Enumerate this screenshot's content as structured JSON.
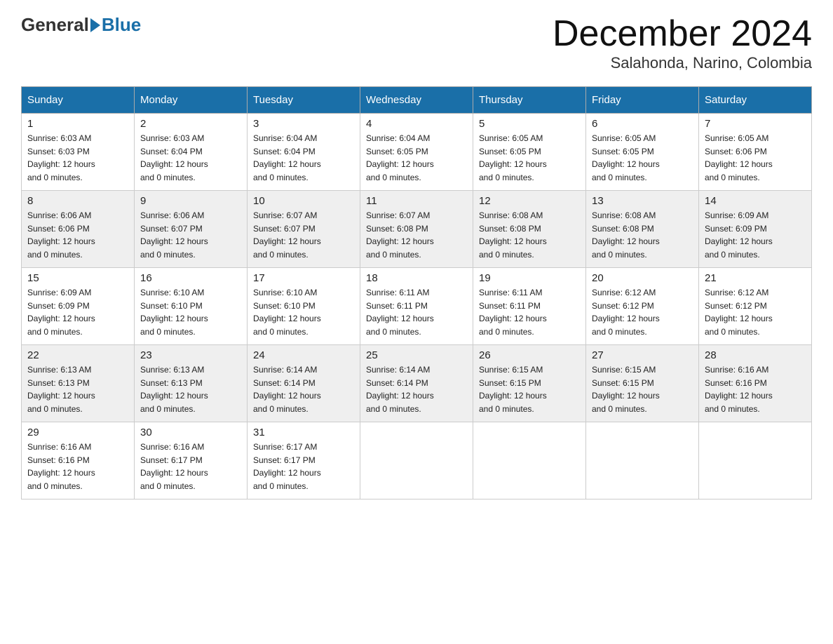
{
  "header": {
    "logo_general": "General",
    "logo_blue": "Blue",
    "month_title": "December 2024",
    "location": "Salahonda, Narino, Colombia"
  },
  "weekdays": [
    "Sunday",
    "Monday",
    "Tuesday",
    "Wednesday",
    "Thursday",
    "Friday",
    "Saturday"
  ],
  "weeks": [
    [
      {
        "day": "1",
        "sunrise": "6:03 AM",
        "sunset": "6:03 PM",
        "daylight": "12 hours and 0 minutes."
      },
      {
        "day": "2",
        "sunrise": "6:03 AM",
        "sunset": "6:04 PM",
        "daylight": "12 hours and 0 minutes."
      },
      {
        "day": "3",
        "sunrise": "6:04 AM",
        "sunset": "6:04 PM",
        "daylight": "12 hours and 0 minutes."
      },
      {
        "day": "4",
        "sunrise": "6:04 AM",
        "sunset": "6:05 PM",
        "daylight": "12 hours and 0 minutes."
      },
      {
        "day": "5",
        "sunrise": "6:05 AM",
        "sunset": "6:05 PM",
        "daylight": "12 hours and 0 minutes."
      },
      {
        "day": "6",
        "sunrise": "6:05 AM",
        "sunset": "6:05 PM",
        "daylight": "12 hours and 0 minutes."
      },
      {
        "day": "7",
        "sunrise": "6:05 AM",
        "sunset": "6:06 PM",
        "daylight": "12 hours and 0 minutes."
      }
    ],
    [
      {
        "day": "8",
        "sunrise": "6:06 AM",
        "sunset": "6:06 PM",
        "daylight": "12 hours and 0 minutes."
      },
      {
        "day": "9",
        "sunrise": "6:06 AM",
        "sunset": "6:07 PM",
        "daylight": "12 hours and 0 minutes."
      },
      {
        "day": "10",
        "sunrise": "6:07 AM",
        "sunset": "6:07 PM",
        "daylight": "12 hours and 0 minutes."
      },
      {
        "day": "11",
        "sunrise": "6:07 AM",
        "sunset": "6:08 PM",
        "daylight": "12 hours and 0 minutes."
      },
      {
        "day": "12",
        "sunrise": "6:08 AM",
        "sunset": "6:08 PM",
        "daylight": "12 hours and 0 minutes."
      },
      {
        "day": "13",
        "sunrise": "6:08 AM",
        "sunset": "6:08 PM",
        "daylight": "12 hours and 0 minutes."
      },
      {
        "day": "14",
        "sunrise": "6:09 AM",
        "sunset": "6:09 PM",
        "daylight": "12 hours and 0 minutes."
      }
    ],
    [
      {
        "day": "15",
        "sunrise": "6:09 AM",
        "sunset": "6:09 PM",
        "daylight": "12 hours and 0 minutes."
      },
      {
        "day": "16",
        "sunrise": "6:10 AM",
        "sunset": "6:10 PM",
        "daylight": "12 hours and 0 minutes."
      },
      {
        "day": "17",
        "sunrise": "6:10 AM",
        "sunset": "6:10 PM",
        "daylight": "12 hours and 0 minutes."
      },
      {
        "day": "18",
        "sunrise": "6:11 AM",
        "sunset": "6:11 PM",
        "daylight": "12 hours and 0 minutes."
      },
      {
        "day": "19",
        "sunrise": "6:11 AM",
        "sunset": "6:11 PM",
        "daylight": "12 hours and 0 minutes."
      },
      {
        "day": "20",
        "sunrise": "6:12 AM",
        "sunset": "6:12 PM",
        "daylight": "12 hours and 0 minutes."
      },
      {
        "day": "21",
        "sunrise": "6:12 AM",
        "sunset": "6:12 PM",
        "daylight": "12 hours and 0 minutes."
      }
    ],
    [
      {
        "day": "22",
        "sunrise": "6:13 AM",
        "sunset": "6:13 PM",
        "daylight": "12 hours and 0 minutes."
      },
      {
        "day": "23",
        "sunrise": "6:13 AM",
        "sunset": "6:13 PM",
        "daylight": "12 hours and 0 minutes."
      },
      {
        "day": "24",
        "sunrise": "6:14 AM",
        "sunset": "6:14 PM",
        "daylight": "12 hours and 0 minutes."
      },
      {
        "day": "25",
        "sunrise": "6:14 AM",
        "sunset": "6:14 PM",
        "daylight": "12 hours and 0 minutes."
      },
      {
        "day": "26",
        "sunrise": "6:15 AM",
        "sunset": "6:15 PM",
        "daylight": "12 hours and 0 minutes."
      },
      {
        "day": "27",
        "sunrise": "6:15 AM",
        "sunset": "6:15 PM",
        "daylight": "12 hours and 0 minutes."
      },
      {
        "day": "28",
        "sunrise": "6:16 AM",
        "sunset": "6:16 PM",
        "daylight": "12 hours and 0 minutes."
      }
    ],
    [
      {
        "day": "29",
        "sunrise": "6:16 AM",
        "sunset": "6:16 PM",
        "daylight": "12 hours and 0 minutes."
      },
      {
        "day": "30",
        "sunrise": "6:16 AM",
        "sunset": "6:17 PM",
        "daylight": "12 hours and 0 minutes."
      },
      {
        "day": "31",
        "sunrise": "6:17 AM",
        "sunset": "6:17 PM",
        "daylight": "12 hours and 0 minutes."
      },
      null,
      null,
      null,
      null
    ]
  ],
  "labels": {
    "sunrise": "Sunrise:",
    "sunset": "Sunset:",
    "daylight": "Daylight:"
  }
}
